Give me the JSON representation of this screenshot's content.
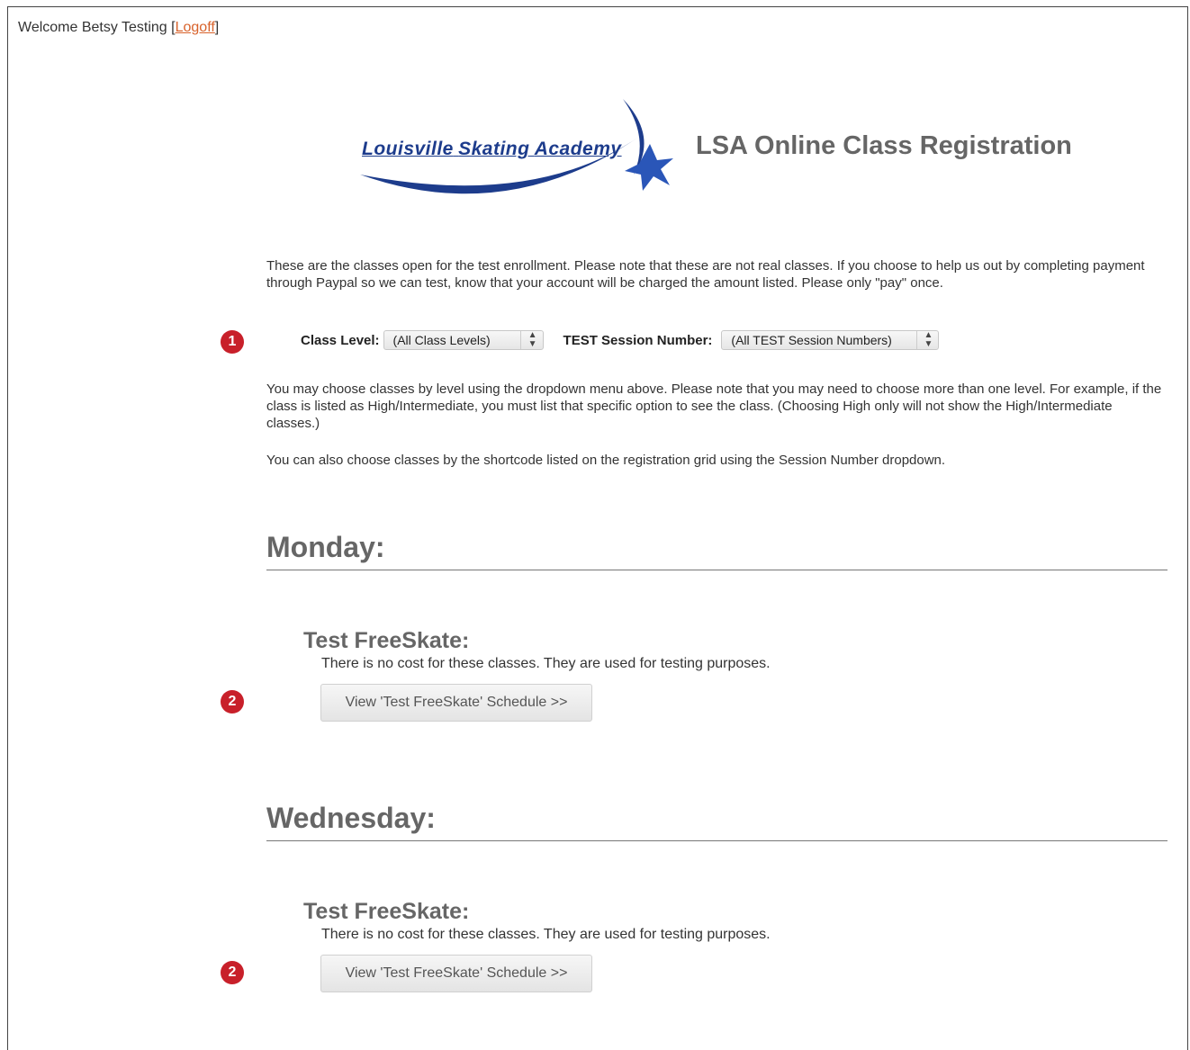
{
  "header": {
    "welcome_text": "Welcome Betsy Testing [",
    "logoff_label": "Logoff",
    "welcome_suffix": "]"
  },
  "brand": {
    "logo_word1": "Louisville",
    "logo_word2": "Skating",
    "logo_word3": "Academy",
    "app_title": "LSA Online Class Registration",
    "logo_colors": {
      "primary": "#1d3c8c",
      "secondary": "#2a56b8"
    }
  },
  "intro_text": "These are the classes open for the test enrollment. Please note that these are not real classes. If you choose to help us out by completing payment through Paypal so we can test, know that your account will be charged the amount listed. Please only \"pay\" once.",
  "filters": {
    "class_level_label": "Class Level:",
    "class_level_value": "(All Class Levels)",
    "session_label": "TEST Session Number:",
    "session_value": "(All TEST Session Numbers)"
  },
  "help_text_1": "You may choose classes by level using the dropdown menu above. Please note that you may need to choose more than one level. For example, if the class is listed as High/Intermediate, you must list that specific option to see the class. (Choosing High only will not show the High/Intermediate classes.)",
  "help_text_2": "You can also choose classes by the shortcode listed on the registration grid using the Session Number dropdown.",
  "markers": {
    "m1": "1",
    "m2": "2",
    "m3": "2"
  },
  "days": [
    {
      "heading": "Monday:",
      "class_title": "Test FreeSkate:",
      "class_desc": "There is no cost for these classes. They are used for testing purposes.",
      "button_label": "View 'Test FreeSkate' Schedule >>"
    },
    {
      "heading": "Wednesday:",
      "class_title": "Test FreeSkate:",
      "class_desc": "There is no cost for these classes. They are used for testing purposes.",
      "button_label": "View 'Test FreeSkate' Schedule >>"
    }
  ],
  "colors": {
    "link": "#d8622b",
    "marker": "#c8202a",
    "heading": "#666666"
  }
}
